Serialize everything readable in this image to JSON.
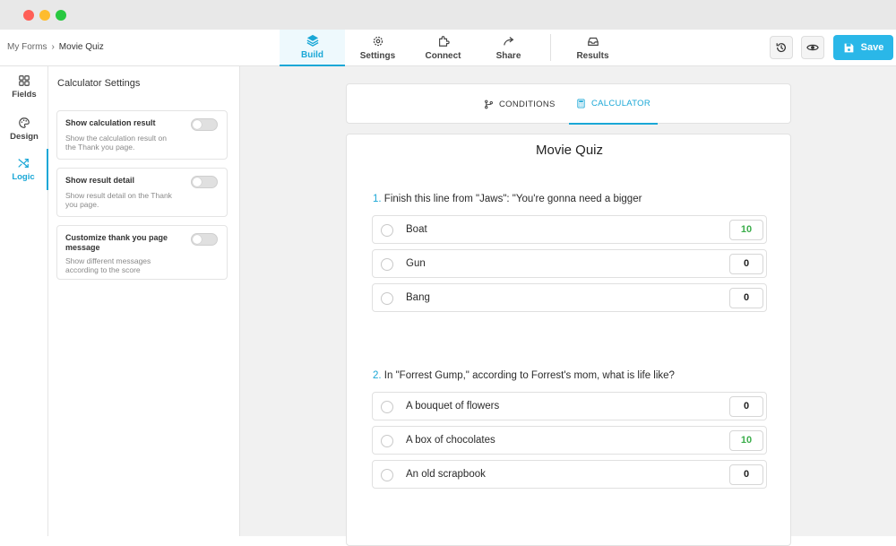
{
  "breadcrumb": {
    "parent": "My Forms",
    "separator": "›",
    "current": "Movie Quiz"
  },
  "nav_tabs": [
    {
      "label": "Build",
      "icon": "layers-icon",
      "active": true
    },
    {
      "label": "Settings",
      "icon": "gear-icon",
      "active": false
    },
    {
      "label": "Connect",
      "icon": "puzzle-icon",
      "active": false
    },
    {
      "label": "Share",
      "icon": "share-arrow-icon",
      "active": false
    },
    {
      "label": "Results",
      "icon": "inbox-icon",
      "active": false
    }
  ],
  "toolbar": {
    "save_label": "Save"
  },
  "left_rail": [
    {
      "label": "Fields",
      "icon": "grid-icon",
      "active": false
    },
    {
      "label": "Design",
      "icon": "palette-icon",
      "active": false
    },
    {
      "label": "Logic",
      "icon": "shuffle-icon",
      "active": true
    }
  ],
  "settings_panel": {
    "title": "Calculator Settings",
    "cards": [
      {
        "title": "Show calculation result",
        "description": "Show the calculation result on the Thank you page.",
        "enabled": false
      },
      {
        "title": "Show result detail",
        "description": "Show result detail on the Thank you page.",
        "enabled": false
      },
      {
        "title": "Customize thank you page message",
        "description": "Show different messages according to the score",
        "enabled": false
      }
    ]
  },
  "subtabs": [
    {
      "label": "CONDITIONS",
      "icon": "branch-icon",
      "active": false
    },
    {
      "label": "CALCULATOR",
      "icon": "calculator-icon",
      "active": true
    }
  ],
  "form": {
    "title": "Movie Quiz",
    "questions": [
      {
        "number": "1.",
        "text": "Finish this line from \"Jaws\": \"You're gonna need a bigger",
        "options": [
          {
            "label": "Boat",
            "score": "10"
          },
          {
            "label": "Gun",
            "score": "0"
          },
          {
            "label": "Bang",
            "score": "0"
          }
        ]
      },
      {
        "number": "2.",
        "text": "In \"Forrest Gump,\" according to Forrest's mom, what is life like?",
        "options": [
          {
            "label": "A bouquet of flowers",
            "score": "0"
          },
          {
            "label": "A box of chocolates",
            "score": "10"
          },
          {
            "label": "An old scrapbook",
            "score": "0"
          }
        ]
      }
    ]
  },
  "colors": {
    "accent": "#1aa7d6",
    "save_button": "#2ab7e8",
    "correct_score": "#3cae4c"
  }
}
